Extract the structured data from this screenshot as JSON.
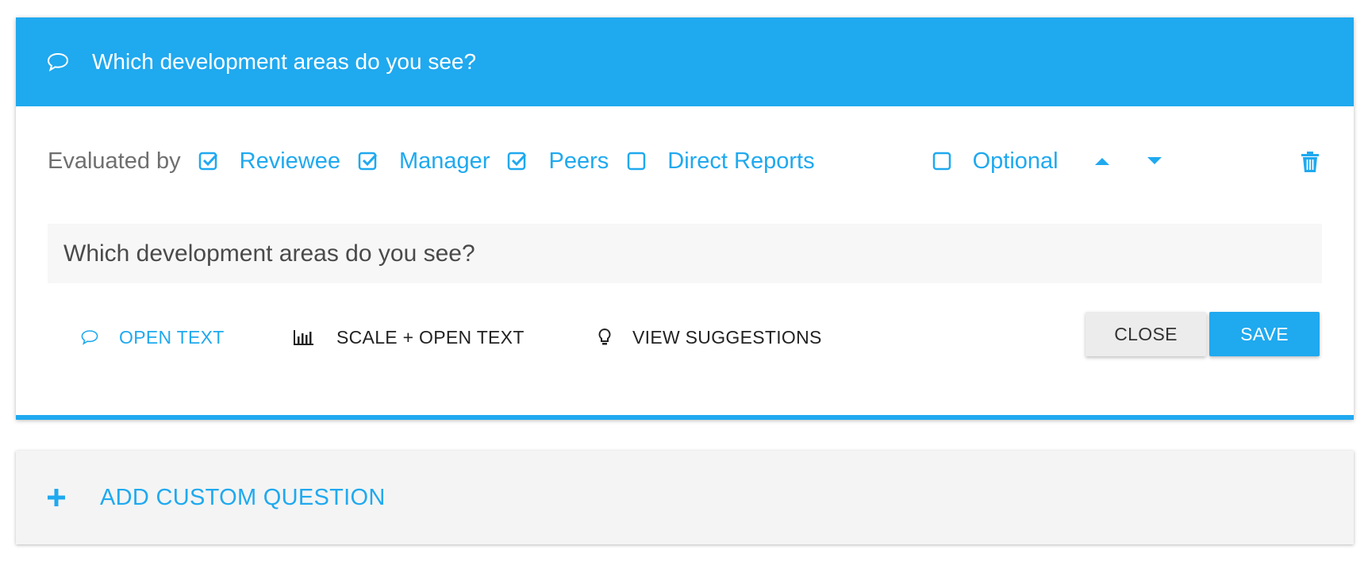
{
  "question_card": {
    "header_title": "Which development areas do you see?",
    "header_icon": "speech-bubble-icon",
    "evaluated_by_label": "Evaluated by",
    "evaluators": [
      {
        "label": "Reviewee",
        "checked": true
      },
      {
        "label": "Manager",
        "checked": true
      },
      {
        "label": "Peers",
        "checked": true
      },
      {
        "label": "Direct Reports",
        "checked": false
      }
    ],
    "optional": {
      "label": "Optional",
      "checked": false
    },
    "question_text": "Which development areas do you see?",
    "types": {
      "open_text": "OPEN TEXT",
      "scale_open_text": "SCALE + OPEN TEXT",
      "view_suggestions": "VIEW SUGGESTIONS"
    },
    "close_label": "CLOSE",
    "save_label": "SAVE"
  },
  "add_custom_question": {
    "label": "ADD CUSTOM QUESTION"
  },
  "colors": {
    "accent": "#1fa9ef",
    "muted_text": "#6f6f6f",
    "input_bg": "#f7f7f7",
    "close_bg": "#ececec"
  }
}
